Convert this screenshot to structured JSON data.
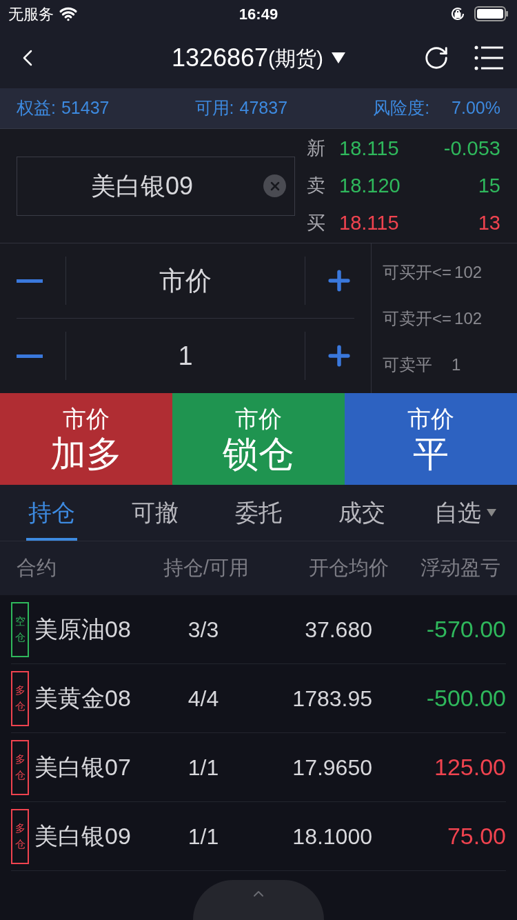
{
  "status_bar": {
    "carrier": "无服务",
    "time": "16:49"
  },
  "nav": {
    "title": "1326867",
    "subtitle": "(期货)"
  },
  "account": [
    {
      "label": "权益:",
      "value": "51437"
    },
    {
      "label": "可用:",
      "value": "47837"
    },
    {
      "label": "风险度:",
      "value": "7.00%"
    }
  ],
  "contract": {
    "value": "美白银09"
  },
  "quotes": [
    {
      "label": "新",
      "price": {
        "text": "18.115",
        "color": "#2fb85c"
      },
      "amount": {
        "text": "-0.053",
        "color": "#2fb85c"
      }
    },
    {
      "label": "卖",
      "price": {
        "text": "18.120",
        "color": "#2fb85c"
      },
      "amount": {
        "text": "15",
        "color": "#2fb85c"
      }
    },
    {
      "label": "买",
      "price": {
        "text": "18.115",
        "color": "#f0434f"
      },
      "amount": {
        "text": "13",
        "color": "#f0434f"
      }
    }
  ],
  "steppers": [
    {
      "value": "市价"
    },
    {
      "value": "1"
    }
  ],
  "limits": [
    {
      "label": "可买开<=",
      "value": "102"
    },
    {
      "label": "可卖开<=",
      "value": "102"
    },
    {
      "label": "可卖平",
      "value": "1"
    }
  ],
  "actions": [
    {
      "top": "市价",
      "bottom": "加多",
      "color": "#b02d33"
    },
    {
      "top": "市价",
      "bottom": "锁仓",
      "color": "#1f9450"
    },
    {
      "top": "市价",
      "bottom": "平",
      "color": "#2d62c1"
    }
  ],
  "tabs": [
    {
      "label": "持仓",
      "selected": true,
      "dropdown": false
    },
    {
      "label": "可撤",
      "selected": false,
      "dropdown": false
    },
    {
      "label": "委托",
      "selected": false,
      "dropdown": false
    },
    {
      "label": "成交",
      "selected": false,
      "dropdown": false
    },
    {
      "label": "自选",
      "selected": false,
      "dropdown": true
    }
  ],
  "table": {
    "columns": [
      "合约",
      "持仓/可用",
      "开仓均价",
      "浮动盈亏"
    ],
    "rows": [
      {
        "side": {
          "text": "空仓",
          "color": "#2fb85c"
        },
        "contract": "美原油08",
        "position": "3/3",
        "avg_price": "37.680",
        "pnl": {
          "text": "-570.00",
          "color": "#2fb85c"
        }
      },
      {
        "side": {
          "text": "多仓",
          "color": "#f0434f"
        },
        "contract": "美黄金08",
        "position": "4/4",
        "avg_price": "1783.95",
        "pnl": {
          "text": "-500.00",
          "color": "#2fb85c"
        }
      },
      {
        "side": {
          "text": "多仓",
          "color": "#f0434f"
        },
        "contract": "美白银07",
        "position": "1/1",
        "avg_price": "17.9650",
        "pnl": {
          "text": "125.00",
          "color": "#f0434f"
        }
      },
      {
        "side": {
          "text": "多仓",
          "color": "#f0434f"
        },
        "contract": "美白银09",
        "position": "1/1",
        "avg_price": "18.1000",
        "pnl": {
          "text": "75.00",
          "color": "#f0434f"
        }
      }
    ]
  }
}
